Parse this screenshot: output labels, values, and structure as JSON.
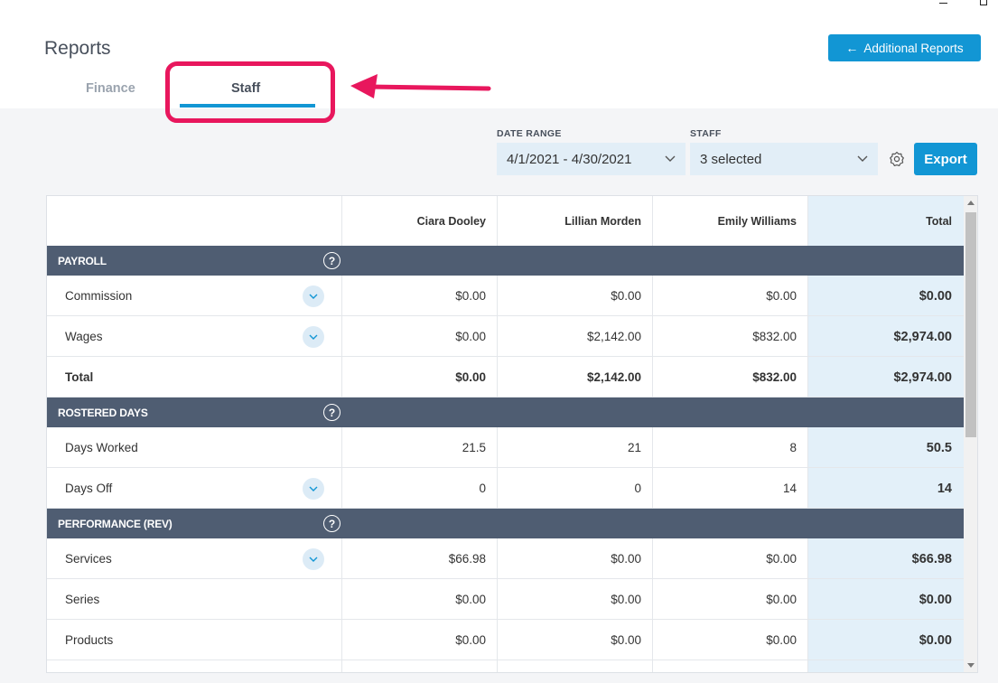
{
  "header": {
    "title": "Reports",
    "additional_reports": "Additional Reports",
    "tabs": [
      {
        "label": "Finance",
        "active": false
      },
      {
        "label": "Staff",
        "active": true
      }
    ]
  },
  "filters": {
    "date_range_label": "DATE RANGE",
    "date_range_value": "4/1/2021 - 4/30/2021",
    "staff_label": "STAFF",
    "staff_value": "3 selected",
    "export_label": "Export"
  },
  "table": {
    "columns": [
      "Ciara Dooley",
      "Lillian Morden",
      "Emily Williams",
      "Total"
    ],
    "sections": [
      {
        "title": "PAYROLL",
        "rows": [
          {
            "label": "Commission",
            "expandable": true,
            "values": [
              "$0.00",
              "$0.00",
              "$0.00",
              "$0.00"
            ]
          },
          {
            "label": "Wages",
            "expandable": true,
            "values": [
              "$0.00",
              "$2,142.00",
              "$832.00",
              "$2,974.00"
            ]
          },
          {
            "label": "Total",
            "bold": true,
            "values": [
              "$0.00",
              "$2,142.00",
              "$832.00",
              "$2,974.00"
            ]
          }
        ]
      },
      {
        "title": "ROSTERED DAYS",
        "rows": [
          {
            "label": "Days Worked",
            "values": [
              "21.5",
              "21",
              "8",
              "50.5"
            ]
          },
          {
            "label": "Days Off",
            "expandable": true,
            "values": [
              "0",
              "0",
              "14",
              "14"
            ]
          }
        ]
      },
      {
        "title": "PERFORMANCE (REV)",
        "rows": [
          {
            "label": "Services",
            "expandable": true,
            "values": [
              "$66.98",
              "$0.00",
              "$0.00",
              "$66.98"
            ]
          },
          {
            "label": "Series",
            "values": [
              "$0.00",
              "$0.00",
              "$0.00",
              "$0.00"
            ]
          },
          {
            "label": "Products",
            "values": [
              "$0.00",
              "$0.00",
              "$0.00",
              "$0.00"
            ]
          }
        ]
      }
    ]
  },
  "colors": {
    "accent": "#1296d4",
    "section_header": "#4f5d72",
    "total_column": "#e3f0f9",
    "annotation": "#e8175d"
  }
}
